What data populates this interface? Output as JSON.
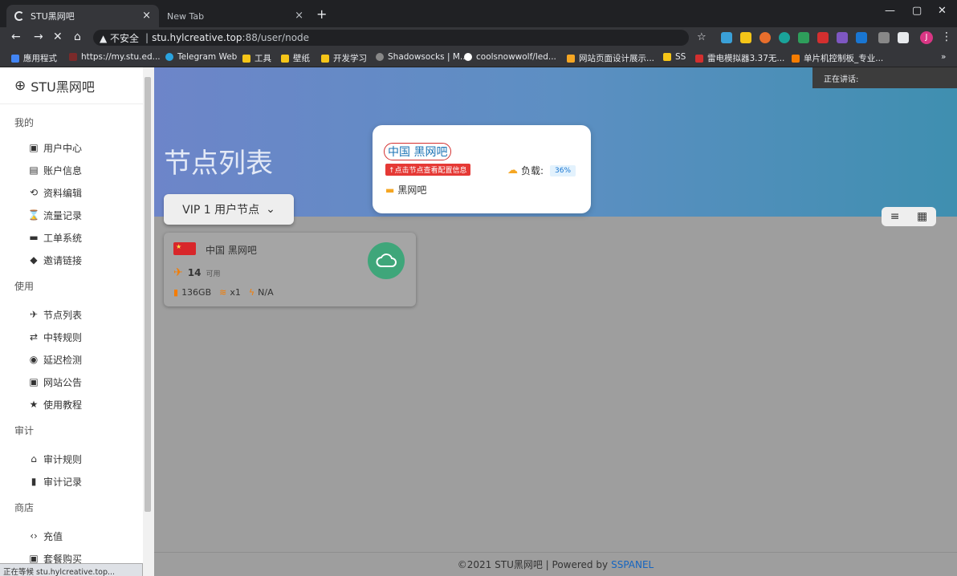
{
  "browser": {
    "tabs": [
      {
        "title": "STU黑网吧",
        "close": "×"
      },
      {
        "title": "New Tab",
        "close": "×"
      }
    ],
    "new_tab": "+",
    "window_controls": [
      "—",
      "▢",
      "✕"
    ],
    "nav": {
      "back": "←",
      "forward": "→",
      "reload": "✕",
      "home": "⌂"
    },
    "url": {
      "warning": "▲ 不安全",
      "separator": "|",
      "host": "stu.hylcreative.top",
      "rest": ":88/user/node"
    },
    "star": "☆",
    "profile_initial": "J",
    "menu": "⋮",
    "bookmarks": [
      {
        "label": "應用程式",
        "color": "#4285f4"
      },
      {
        "label": "https://my.stu.ed...",
        "color": "#7a2a2a"
      },
      {
        "label": "Telegram Web",
        "color": "#2aa3df"
      },
      {
        "label": "工具",
        "color": "#f5c518"
      },
      {
        "label": "壁纸",
        "color": "#f5c518"
      },
      {
        "label": "开发学习",
        "color": "#f5c518"
      },
      {
        "label": "Shadowsocks | M...",
        "color": "#888888"
      },
      {
        "label": "coolsnowwolf/led...",
        "color": "#ffffff"
      },
      {
        "label": "网站页面设计展示...",
        "color": "#f5a623"
      },
      {
        "label": "SS",
        "color": "#f5c518"
      },
      {
        "label": "雷电模拟器3.37无...",
        "color": "#d32f2f"
      },
      {
        "label": "单片机控制板_专业...",
        "color": "#f57c00"
      }
    ],
    "bookmarks_more": "»",
    "talking": "正在讲话:",
    "status": "正在等候 stu.hylcreative.top..."
  },
  "sidebar": {
    "brand": "STU黑网吧",
    "sections": [
      {
        "title": "我的",
        "items": [
          {
            "icon": "▣",
            "label": "用户中心"
          },
          {
            "icon": "▤",
            "label": "账户信息"
          },
          {
            "icon": "⟲",
            "label": "资料编辑"
          },
          {
            "icon": "⌛",
            "label": "流量记录"
          },
          {
            "icon": "▬",
            "label": "工单系统"
          },
          {
            "icon": "◆",
            "label": "邀请链接"
          }
        ]
      },
      {
        "title": "使用",
        "items": [
          {
            "icon": "✈",
            "label": "节点列表"
          },
          {
            "icon": "⇄",
            "label": "中转规则"
          },
          {
            "icon": "◉",
            "label": "延迟检测"
          },
          {
            "icon": "▣",
            "label": "网站公告"
          },
          {
            "icon": "★",
            "label": "使用教程"
          }
        ]
      },
      {
        "title": "审计",
        "items": [
          {
            "icon": "⌂",
            "label": "审计规则"
          },
          {
            "icon": "▮",
            "label": "审计记录"
          }
        ]
      },
      {
        "title": "商店",
        "items": [
          {
            "icon": "‹›",
            "label": "充值"
          },
          {
            "icon": "▣",
            "label": "套餐购买"
          }
        ]
      }
    ]
  },
  "main": {
    "title": "节点列表",
    "group": "VIP 1 用户节点",
    "group_chevron": "⌄",
    "view_list_icon": "≡",
    "view_grid_icon": "▦",
    "node": {
      "name": "中国 黑网吧",
      "online": "14",
      "online_label": "可用",
      "traffic": "136GB",
      "rate": "x1",
      "speed": "N/A"
    },
    "popup": {
      "name": "中国 黑网吧",
      "tag": "↑点击节点查看配置信息",
      "load_label": "负载:",
      "load_value": "36%",
      "desc": "黑网吧"
    },
    "footer": {
      "copyright": "©2021 STU黑网吧 | Powered by",
      "powered": "SSPANEL"
    }
  }
}
